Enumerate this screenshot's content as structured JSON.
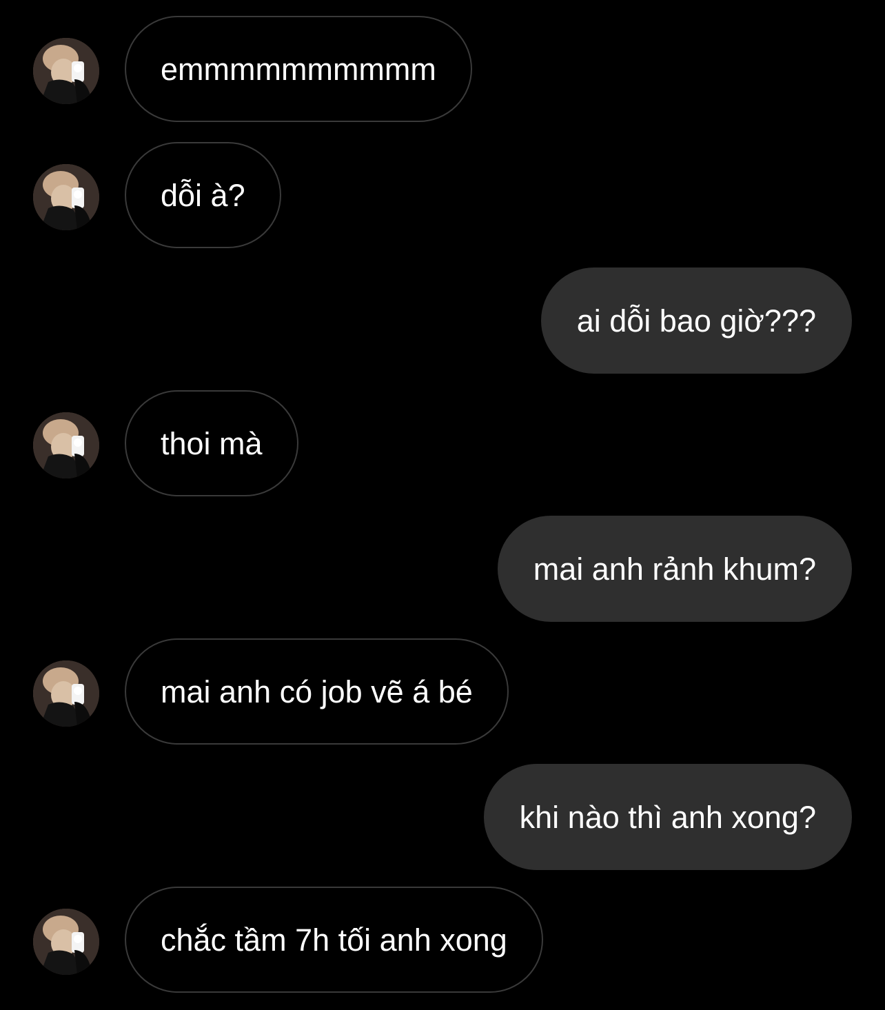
{
  "conversation": {
    "messages": [
      {
        "sender": "other",
        "text": "emmmmmmmmmm"
      },
      {
        "sender": "other",
        "text": "dỗi à?"
      },
      {
        "sender": "me",
        "text": "ai dỗi bao giờ???"
      },
      {
        "sender": "other",
        "text": "thoi mà"
      },
      {
        "sender": "me",
        "text": "mai anh rảnh khum?"
      },
      {
        "sender": "other",
        "text": "mai anh có job vẽ á bé"
      },
      {
        "sender": "me",
        "text": "khi nào thì anh xong?"
      },
      {
        "sender": "other",
        "text": "chắc tầm 7h tối anh xong"
      }
    ]
  },
  "colors": {
    "background": "#000000",
    "incoming_border": "#3a3a3a",
    "outgoing_bubble": "#2f2f2f",
    "text": "#ffffff"
  }
}
